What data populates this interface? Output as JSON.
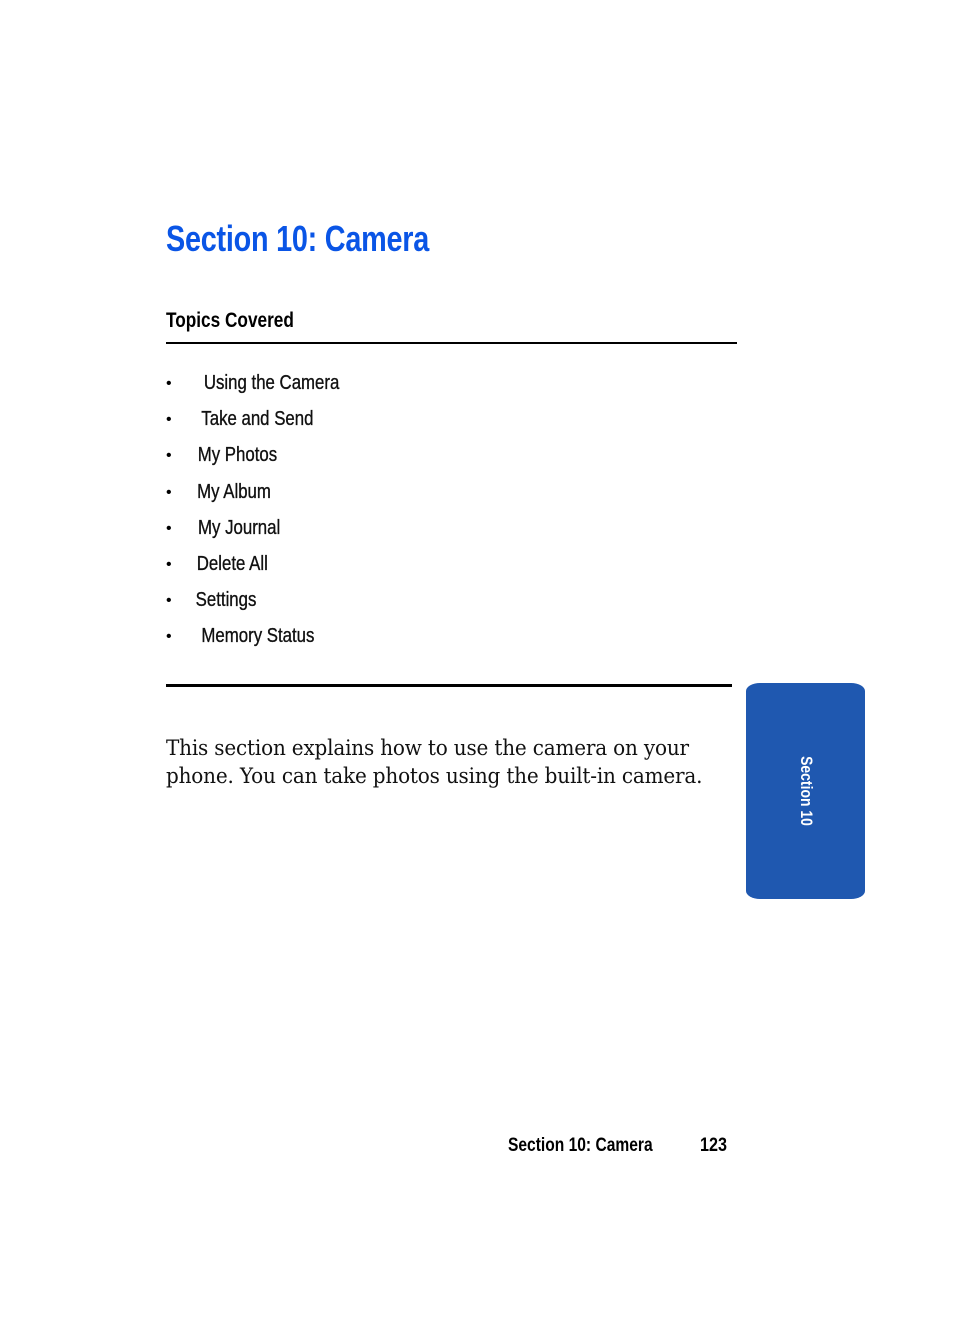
{
  "page": {
    "title": "Section 10: Camera",
    "topics_heading": "Topics Covered",
    "topics": [
      "Using the Camera",
      "Take and Send",
      "My Photos",
      "My Album",
      "My Journal",
      "Delete All",
      "Settings",
      "Memory Status"
    ],
    "bullet_glyph": "•",
    "intro": "This section explains how to use the camera on your phone. You can take photos using the built-in camera.",
    "side_tab": "Section 10",
    "footer": {
      "section": "Section 10: Camera",
      "page_number": "123"
    }
  },
  "colors": {
    "title": "#0a55e6",
    "tab": "#1f58b0"
  }
}
